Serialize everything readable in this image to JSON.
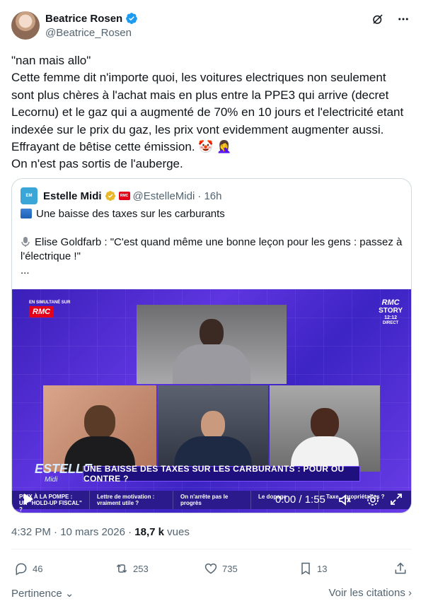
{
  "author": {
    "display_name": "Beatrice Rosen",
    "handle": "@Beatrice_Rosen"
  },
  "tweet": {
    "lines": [
      "\"nan mais allo\"",
      "Cette femme dit n'importe quoi, les voitures electriques non seulement sont plus chères à l'achat mais en plus entre la PPE3 qui arrive (decret Lecornu) et le gaz qui a augmenté de 70% en 10 jours et l'electricité etant indexée sur le prix du gaz, les prix vont evidemment augmenter aussi.",
      "Effrayant de bêtise cette émission. 🤡 🤦‍♀️",
      "On n'est pas sortis de l'auberge."
    ]
  },
  "quote": {
    "name": "Estelle Midi",
    "handle": "@EstelleMidi",
    "time": "· 16h",
    "line1": "Une baisse des taxes sur les carburants",
    "line2": "Elise Goldfarb : \"C'est quand même une bonne leçon pour les gens : passez à l'électrique !\"",
    "ellipsis": "...",
    "video": {
      "simul": "EN SIMULTANÉ SUR",
      "rmc": "RMC",
      "story1": "RMC",
      "story2": "STORY",
      "story_time": "12:12",
      "story_direct": "DIRECT",
      "show_name": "ESTELLE",
      "show_name_small": "Midi",
      "banner": "UNE BAISSE DES TAXES SUR LES CARBURANTS : POUR OU CONTRE ?",
      "ticker": [
        "PRIX À LA POMPE : UN \"HOLD-UP FISCAL\" ?",
        "Lettre de motivation : vraiment utile ?",
        "On n'arrête pas le progrès",
        "Le dopage",
        "Taxe... propriétaires ?"
      ],
      "time": "0:00 / 1:55"
    }
  },
  "meta": {
    "time": "4:32 PM · 10 mars 2026",
    "sep": "·",
    "views_count": "18,7 k",
    "views_label": "vues"
  },
  "actions": {
    "replies": "46",
    "reposts": "253",
    "likes": "735",
    "bookmarks": "13"
  },
  "footer": {
    "left": "Pertinence",
    "right": "Voir les citations"
  },
  "colors": {
    "verified_blue": "#1d9bf0",
    "gold": "#e8b829",
    "rmc_red": "#e2001a",
    "secondary_text": "#536471"
  }
}
